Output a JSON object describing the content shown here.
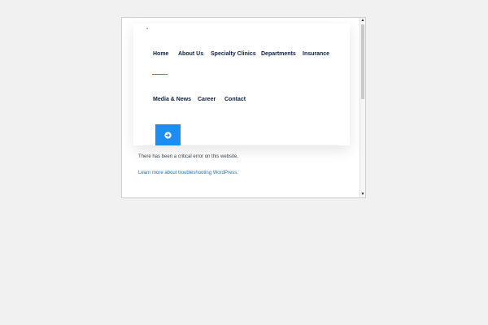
{
  "nav": {
    "row1": [
      "Home",
      "About Us",
      "Specialty Clinics",
      "Departments",
      "Insurance"
    ],
    "row2": [
      "Media & News",
      "Career",
      "Contact"
    ],
    "active": "Home"
  },
  "go_button": {
    "icon": "arrow-right-circle-icon"
  },
  "error": {
    "message": "There has been a critical error on this website.",
    "link_text": "Learn more about troubleshooting WordPress."
  },
  "colors": {
    "accent": "#1a8ef3",
    "nav_text": "#0f1e3d",
    "link": "#2271b1",
    "background": "#f1f1f1"
  }
}
